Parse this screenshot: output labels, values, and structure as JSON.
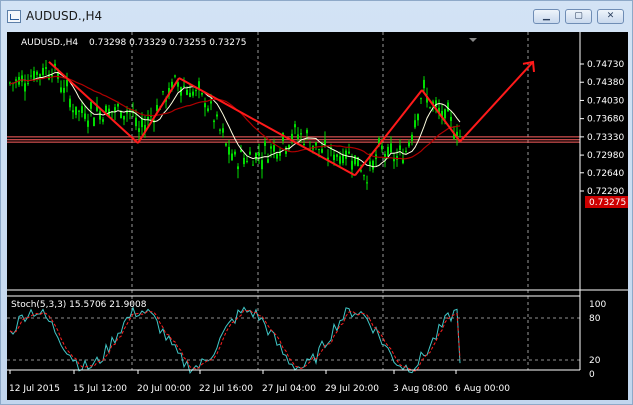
{
  "window": {
    "title": "AUDUSD.,H4",
    "minimize_label": "▁",
    "maximize_label": "▢",
    "close_label": "✕"
  },
  "colors": {
    "background": "#000000",
    "candles": "#00dd00",
    "fast_ma": "#ffffe0",
    "slow_ma": "#b00000",
    "zigzag": "#ff1a1a",
    "current_price_bg": "#cc0000",
    "stoch_main": "#40c8c8",
    "stoch_signal": "#ff2020",
    "grid": "#c0c0c0"
  },
  "chart_data": {
    "type": "candlestick",
    "title": "AUDUSD.,H4  0.73298 0.73329 0.73255 0.73275",
    "symbol_line": "AUDUSD.,H4",
    "ohlc_line": "0.73298 0.73329 0.73255 0.73275",
    "current_price": "0.73275",
    "y_ticks": [
      "0.74730",
      "0.74380",
      "0.74030",
      "0.73680",
      "0.73330",
      "0.72980",
      "0.72640",
      "0.72290"
    ],
    "y_tick_values": [
      0.7473,
      0.7438,
      0.7403,
      0.7368,
      0.7333,
      0.7298,
      0.7264,
      0.7229
    ],
    "x_labels": [
      "12 Jul 2015",
      "15 Jul 12:00",
      "20 Jul 00:00",
      "22 Jul 16:00",
      "27 Jul 04:00",
      "29 Jul 20:00",
      "3 Aug 08:00",
      "6 Aug 00:00"
    ],
    "zigzag_points": [
      0.7477,
      0.7321,
      0.7446,
      0.7259,
      0.7423,
      0.7324
    ],
    "arrow_target": 0.7477,
    "grid": true,
    "stochastic": {
      "label": "Stoch(5,3,3) 15.5706 21.9008",
      "y_ticks": [
        "100",
        "80",
        "20",
        "0"
      ],
      "main_current": 15.5706,
      "signal_current": 21.9008,
      "levels": [
        80,
        20
      ]
    }
  }
}
